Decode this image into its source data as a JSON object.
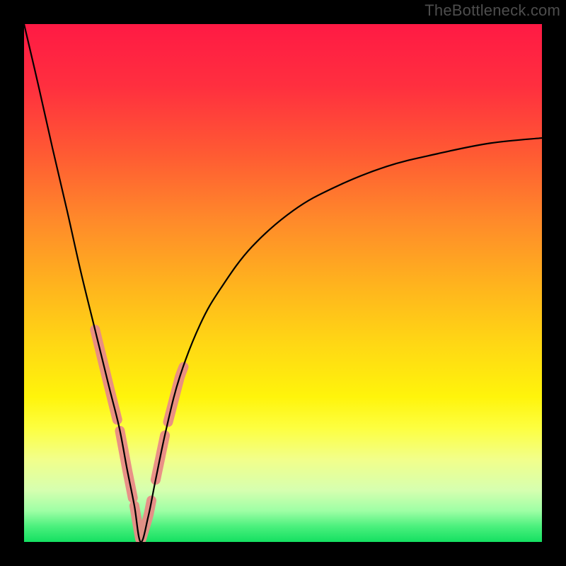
{
  "watermark": "TheBottleneck.com",
  "gradient": {
    "stops": [
      {
        "offset": 0.0,
        "color": "#ff1a44"
      },
      {
        "offset": 0.12,
        "color": "#ff2f3f"
      },
      {
        "offset": 0.25,
        "color": "#ff5a33"
      },
      {
        "offset": 0.38,
        "color": "#ff8a2a"
      },
      {
        "offset": 0.5,
        "color": "#ffb21e"
      },
      {
        "offset": 0.62,
        "color": "#ffd814"
      },
      {
        "offset": 0.72,
        "color": "#fff40b"
      },
      {
        "offset": 0.78,
        "color": "#fdff40"
      },
      {
        "offset": 0.84,
        "color": "#f2ff8a"
      },
      {
        "offset": 0.9,
        "color": "#d6ffb0"
      },
      {
        "offset": 0.94,
        "color": "#9effa5"
      },
      {
        "offset": 0.97,
        "color": "#4bf07d"
      },
      {
        "offset": 1.0,
        "color": "#14e061"
      }
    ]
  },
  "chart_data": {
    "type": "line",
    "title": "",
    "xlabel": "",
    "ylabel": "",
    "xlim": [
      0,
      100
    ],
    "ylim": [
      0,
      100
    ],
    "grid": false,
    "note": "Bottleneck-style V-curve; minimum (0 %) at x≈22.5, rises to ~100 % at x=0 and ~78 % at x=100.",
    "series": [
      {
        "name": "bottleneck-curve",
        "color": "#000000",
        "x": [
          0.0,
          2.8,
          5.5,
          8.3,
          11.0,
          13.7,
          16.4,
          18.4,
          19.9,
          21.3,
          22.5,
          24.0,
          25.4,
          27.5,
          30.1,
          34.0,
          38.0,
          44.0,
          52.0,
          60.0,
          70.0,
          80.0,
          90.0,
          100.0
        ],
        "y": [
          100.0,
          88.0,
          76.0,
          64.0,
          52.0,
          41.0,
          30.0,
          22.0,
          14.0,
          7.0,
          0.0,
          5.0,
          12.0,
          22.0,
          32.0,
          42.0,
          49.0,
          57.0,
          64.0,
          68.5,
          72.5,
          75.0,
          77.0,
          78.0
        ]
      }
    ],
    "marker_segments": [
      {
        "x_range": [
          13.7,
          18.0
        ],
        "y_range": [
          23.0,
          38.0
        ],
        "color": "#e98b86"
      },
      {
        "x_range": [
          18.5,
          21.0
        ],
        "y_range": [
          6.0,
          20.0
        ],
        "color": "#e98b86"
      },
      {
        "x_range": [
          21.3,
          24.6
        ],
        "y_range": [
          0.0,
          2.0
        ],
        "color": "#e98b86"
      },
      {
        "x_range": [
          25.4,
          27.2
        ],
        "y_range": [
          11.0,
          20.0
        ],
        "color": "#e98b86"
      },
      {
        "x_range": [
          27.8,
          30.8
        ],
        "y_range": [
          22.0,
          34.0
        ],
        "color": "#e98b86"
      }
    ]
  }
}
